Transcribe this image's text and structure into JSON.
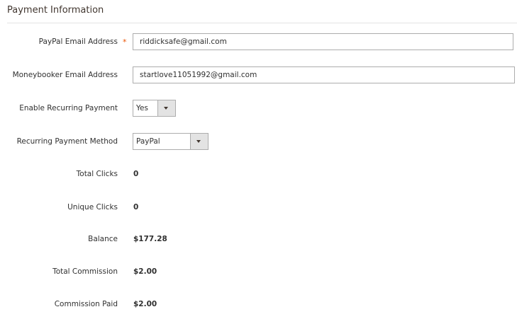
{
  "section": {
    "title": "Payment Information"
  },
  "fields": {
    "paypal_email": {
      "label": "PayPal Email Address",
      "required_mark": "*",
      "value": "riddicksafe@gmail.com"
    },
    "moneybooker_email": {
      "label": "Moneybooker Email Address",
      "value": "startlove11051992@gmail.com"
    },
    "enable_recurring": {
      "label": "Enable Recurring Payment",
      "value": "Yes"
    },
    "recurring_method": {
      "label": "Recurring Payment Method",
      "value": "PayPal"
    },
    "total_clicks": {
      "label": "Total Clicks",
      "value": "0"
    },
    "unique_clicks": {
      "label": "Unique Clicks",
      "value": "0"
    },
    "balance": {
      "label": "Balance",
      "value": "$177.28"
    },
    "total_commission": {
      "label": "Total Commission",
      "value": "$2.00"
    },
    "commission_paid": {
      "label": "Commission Paid",
      "value": "$2.00"
    }
  },
  "colors": {
    "required": "#eb5202",
    "border": "#adadad",
    "select_arrow_bg": "#e3e3e3"
  },
  "icons": {
    "select_arrow": "chevron-down-icon"
  }
}
